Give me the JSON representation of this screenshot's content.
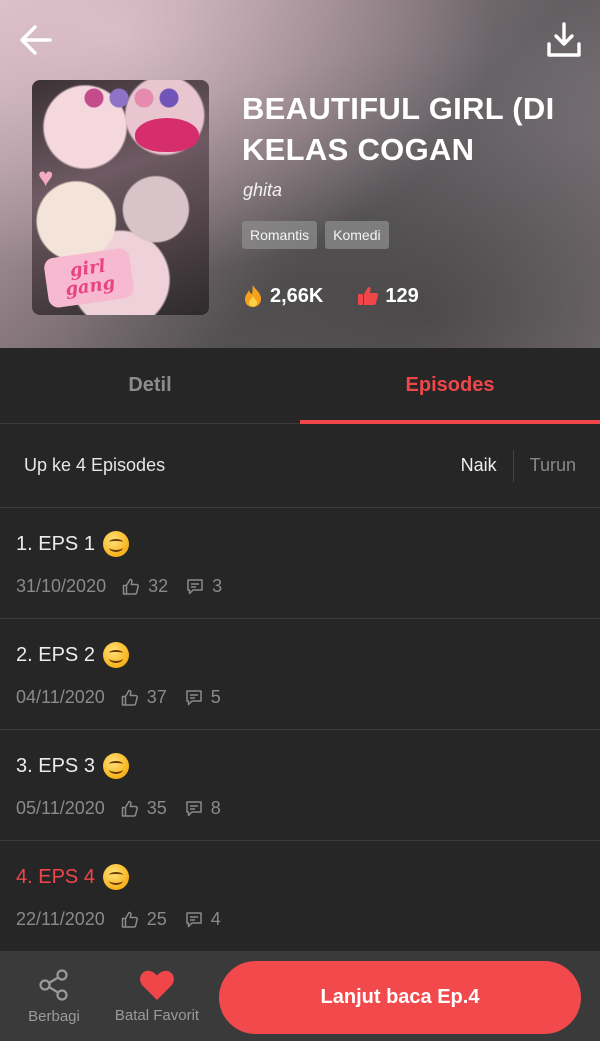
{
  "header": {
    "title": "BEAUTIFUL GIRL (DI KELAS COGAN",
    "author": "ghita",
    "tags": [
      "Romantis",
      "Komedi"
    ],
    "views": "2,66K",
    "likes": "129",
    "cover_sticker_text": "girl gang"
  },
  "tabs": [
    {
      "label": "Detil",
      "active": false
    },
    {
      "label": "Episodes",
      "active": true
    }
  ],
  "episodes_header": {
    "count_text": "Up ke 4 Episodes",
    "sort_asc": "Naik",
    "sort_desc": "Turun"
  },
  "episodes": [
    {
      "title": "1. EPS 1",
      "date": "31/10/2020",
      "likes": "32",
      "comments": "3",
      "current": false
    },
    {
      "title": "2. EPS 2",
      "date": "04/11/2020",
      "likes": "37",
      "comments": "5",
      "current": false
    },
    {
      "title": "3. EPS 3",
      "date": "05/11/2020",
      "likes": "35",
      "comments": "8",
      "current": false
    },
    {
      "title": "4. EPS 4",
      "date": "22/11/2020",
      "likes": "25",
      "comments": "4",
      "current": true
    }
  ],
  "bottom_bar": {
    "share_label": "Berbagi",
    "favorite_label": "Batal Favorit",
    "cta_label": "Lanjut baca Ep.4"
  },
  "colors": {
    "accent": "#f0464a",
    "background": "#262626",
    "bottom_bar": "#3a3a3a"
  },
  "icons": {
    "back": "arrow-left-icon",
    "download": "download-icon",
    "views": "fire-icon",
    "likes": "thumbs-up-icon",
    "comments": "comment-icon",
    "share": "share-icon",
    "favorite": "heart-icon",
    "emoji": "smiling-face-icon"
  }
}
